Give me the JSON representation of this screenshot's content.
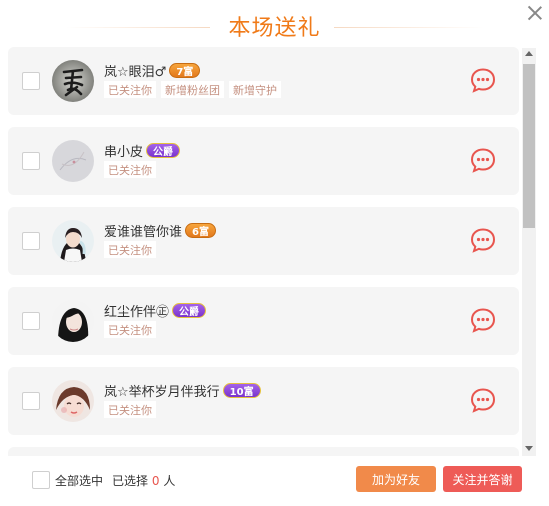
{
  "dialog": {
    "title": "本场送礼",
    "close_icon": "close-icon"
  },
  "colors": {
    "accent": "#f07a18",
    "tag_text": "#c59181",
    "chat_icon": "#e8554e",
    "fu_badge": "#ef8a2a",
    "gong_badge": "#8a3fd6"
  },
  "users": [
    {
      "name": "岚☆眼泪♂",
      "badge": "7富",
      "badge_type": "fu",
      "tags": [
        "已关注你",
        "新增粉丝团",
        "新增守护"
      ],
      "chat_icon": "chat-bubble-icon"
    },
    {
      "name": "串小皮",
      "badge": "公爵",
      "badge_type": "gong",
      "tags": [
        "已关注你"
      ],
      "chat_icon": "chat-bubble-icon"
    },
    {
      "name": "爱谁谁管你谁",
      "badge": "6富",
      "badge_type": "fu",
      "tags": [
        "已关注你"
      ],
      "chat_icon": "chat-bubble-icon"
    },
    {
      "name": "红尘作伴㊣",
      "badge": "公爵",
      "badge_type": "gong",
      "tags": [
        "已关注你"
      ],
      "chat_icon": "chat-bubble-icon"
    },
    {
      "name": "岚☆举杯岁月伴我行",
      "badge": "10富",
      "badge_type": "gong",
      "tags": [
        "已关注你"
      ],
      "chat_icon": "chat-bubble-icon"
    }
  ],
  "footer": {
    "select_all_label": "全部选中",
    "selected_prefix": "已选择",
    "selected_count": "0",
    "selected_suffix": "人",
    "add_friend_label": "加为好友",
    "follow_thank_label": "关注并答谢"
  }
}
